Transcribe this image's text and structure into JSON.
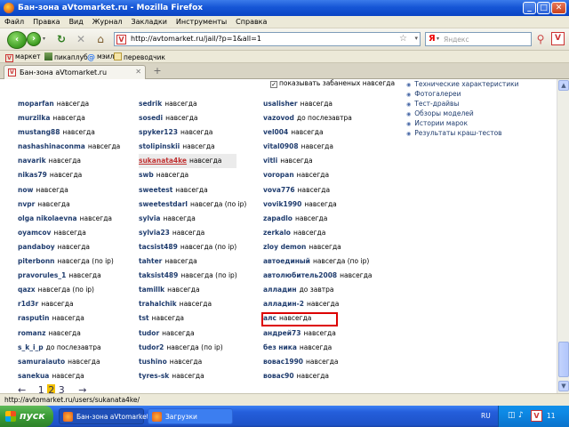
{
  "window": {
    "title": "Бан-зона aVtomarket.ru - Mozilla Firefox"
  },
  "menu": [
    "Файл",
    "Правка",
    "Вид",
    "Журнал",
    "Закладки",
    "Инструменты",
    "Справка"
  ],
  "nav": {
    "url": "http://avtomarket.ru/jail/?p=1&all=1",
    "search_placeholder": "Яндекс"
  },
  "bookmarks": [
    "маркет",
    "пикаплуб",
    "мэил",
    "переводчик"
  ],
  "tab": {
    "label": "Бан-зона aVtomarket.ru",
    "new_tab": "+"
  },
  "content": {
    "show_banned_label": "показывать забаненых навсегда",
    "side_links": [
      "Технические характеристики",
      "Фотогалереи",
      "Тест-драйвы",
      "Обзоры моделей",
      "Истории марок",
      "Результаты краш-тестов"
    ],
    "col1": [
      {
        "name": "moparfan",
        "status": "навсегда"
      },
      {
        "name": "murzilka",
        "status": "навсегда"
      },
      {
        "name": "mustang88",
        "status": "навсегда"
      },
      {
        "name": "nashashinaconma",
        "status": "навсегда"
      },
      {
        "name": "navarik",
        "status": "навсегда"
      },
      {
        "name": "nikas79",
        "status": "навсегда"
      },
      {
        "name": "now",
        "status": "навсегда"
      },
      {
        "name": "nvpr",
        "status": "навсегда"
      },
      {
        "name": "olga nikolaevna",
        "status": "навсегда"
      },
      {
        "name": "oyamcov",
        "status": "навсегда"
      },
      {
        "name": "pandaboy",
        "status": "навсегда"
      },
      {
        "name": "piterbonn",
        "status": "навсегда (по ip)"
      },
      {
        "name": "pravorules_1",
        "status": "навсегда"
      },
      {
        "name": "qazx",
        "status": "навсегда (по ip)"
      },
      {
        "name": "r1d3r",
        "status": "навсегда"
      },
      {
        "name": "rasputin",
        "status": "навсегда"
      },
      {
        "name": "romanz",
        "status": "навсегда"
      },
      {
        "name": "s_k_i_p",
        "status": "до послезавтра"
      },
      {
        "name": "samuraiauto",
        "status": "навсегда"
      },
      {
        "name": "sanekua",
        "status": "навсегда"
      }
    ],
    "col2": [
      {
        "name": "sedrik",
        "status": "навсегда"
      },
      {
        "name": "sosedi",
        "status": "навсегда"
      },
      {
        "name": "spyker123",
        "status": "навсегда"
      },
      {
        "name": "stolipinskii",
        "status": "навсегда"
      },
      {
        "name": "sukanata4ke",
        "status": "навсегда"
      },
      {
        "name": "swb",
        "status": "навсегда"
      },
      {
        "name": "sweetest",
        "status": "навсегда"
      },
      {
        "name": "sweetestdarl",
        "status": "навсегда (по ip)"
      },
      {
        "name": "sylvia",
        "status": "навсегда"
      },
      {
        "name": "sylvia23",
        "status": "навсегда"
      },
      {
        "name": "tacsist489",
        "status": "навсегда (по ip)"
      },
      {
        "name": "tahter",
        "status": "навсегда"
      },
      {
        "name": "taksist489",
        "status": "навсегда (по ip)"
      },
      {
        "name": "tamillk",
        "status": "навсегда"
      },
      {
        "name": "trahalchik",
        "status": "навсегда"
      },
      {
        "name": "tst",
        "status": "навсегда"
      },
      {
        "name": "tudor",
        "status": "навсегда"
      },
      {
        "name": "tudor2",
        "status": "навсегда (по ip)"
      },
      {
        "name": "tushino",
        "status": "навсегда"
      },
      {
        "name": "tyres-sk",
        "status": "навсегда"
      }
    ],
    "col3": [
      {
        "name": "usalisher",
        "status": "навсегда"
      },
      {
        "name": "vazovod",
        "status": "до послезавтра"
      },
      {
        "name": "vel004",
        "status": "навсегда"
      },
      {
        "name": "vital0908",
        "status": "навсегда"
      },
      {
        "name": "vitli",
        "status": "навсегда"
      },
      {
        "name": "voropan",
        "status": "навсегда"
      },
      {
        "name": "vova776",
        "status": "навсегда"
      },
      {
        "name": "vovik1990",
        "status": "навсегда"
      },
      {
        "name": "zapadlo",
        "status": "навсегда"
      },
      {
        "name": "zerkalo",
        "status": "навсегда"
      },
      {
        "name": "zloy demon",
        "status": "навсегда"
      },
      {
        "name": "автоединый",
        "status": "навсегда (по ip)"
      },
      {
        "name": "автолюбитель2008",
        "status": "навсегда"
      },
      {
        "name": "алладин",
        "status": "до завтра"
      },
      {
        "name": "алладин-2",
        "status": "навсегда"
      },
      {
        "name": "алс",
        "status": "навсегда"
      },
      {
        "name": "андрей73",
        "status": "навсегда"
      },
      {
        "name": "без ника",
        "status": "навсегда"
      },
      {
        "name": "вовас1990",
        "status": "навсегда"
      },
      {
        "name": "вовас90",
        "status": "навсегда"
      }
    ],
    "pager": {
      "prev": "←",
      "pages": [
        "1",
        "2",
        "3"
      ],
      "current": "2",
      "next": "→"
    }
  },
  "status_bar": {
    "text": "http://avtomarket.ru/users/sukanata4ke/"
  },
  "taskbar": {
    "start": "пуск",
    "items": [
      "Бан-зона aVtomarket...",
      "Загрузки"
    ],
    "lang": "RU",
    "clock": "11"
  }
}
